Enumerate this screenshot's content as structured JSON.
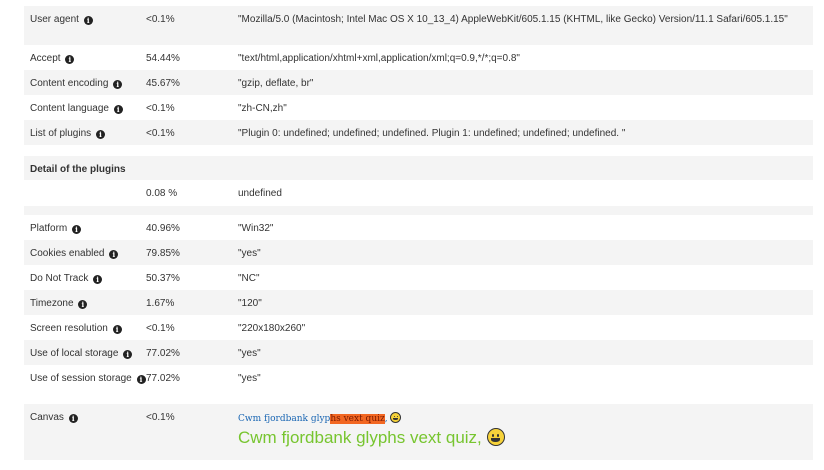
{
  "rows": {
    "user_agent": {
      "label": "User agent",
      "pct": "<0.1%",
      "value": "\"Mozilla/5.0 (Macintosh; Intel Mac OS X 10_13_4) AppleWebKit/605.1.15 (KHTML, like Gecko) Version/11.1 Safari/605.1.15\""
    },
    "accept": {
      "label": "Accept",
      "pct": "54.44%",
      "value": "\"text/html,application/xhtml+xml,application/xml;q=0.9,*/*;q=0.8\""
    },
    "content_encoding": {
      "label": "Content encoding",
      "pct": "45.67%",
      "value": "\"gzip, deflate, br\""
    },
    "content_language": {
      "label": "Content language",
      "pct": "<0.1%",
      "value": "\"zh-CN,zh\""
    },
    "plugins": {
      "label": "List of plugins",
      "pct": "<0.1%",
      "value": "\"Plugin 0: undefined; undefined; undefined. Plugin 1: undefined; undefined; undefined. \""
    },
    "plugin_detail": {
      "label": "Detail of the plugins",
      "pct": "0.08 %",
      "value": "undefined"
    },
    "platform": {
      "label": "Platform",
      "pct": "40.96%",
      "value": "\"Win32\""
    },
    "cookies": {
      "label": "Cookies enabled",
      "pct": "79.85%",
      "value": "\"yes\""
    },
    "dnt": {
      "label": "Do Not Track",
      "pct": "50.37%",
      "value": "\"NC\""
    },
    "timezone": {
      "label": "Timezone",
      "pct": "1.67%",
      "value": "\"120\""
    },
    "screen": {
      "label": "Screen resolution",
      "pct": "<0.1%",
      "value": "\"220x180x260\""
    },
    "local_storage": {
      "label": "Use of local storage",
      "pct": "77.02%",
      "value": "\"yes\""
    },
    "session_storage": {
      "label": "Use of session storage",
      "pct": "77.02%",
      "value": "\"yes\""
    },
    "canvas": {
      "label": "Canvas",
      "pct": "<0.1%",
      "small_text_a": "Cwm fjordbank glyp",
      "small_text_hl": "hs vext quiz",
      "small_text_b": ",",
      "big_text": "Cwm fjordbank glyphs vext quiz,"
    }
  },
  "icons": {
    "info": "info-circle-icon",
    "emoji": "smiley-face-icon"
  },
  "colors": {
    "stripe": "#f4f4f4",
    "canvas_blue": "#1a66b3",
    "canvas_orange": "#f26722",
    "canvas_green": "#77c52f"
  }
}
